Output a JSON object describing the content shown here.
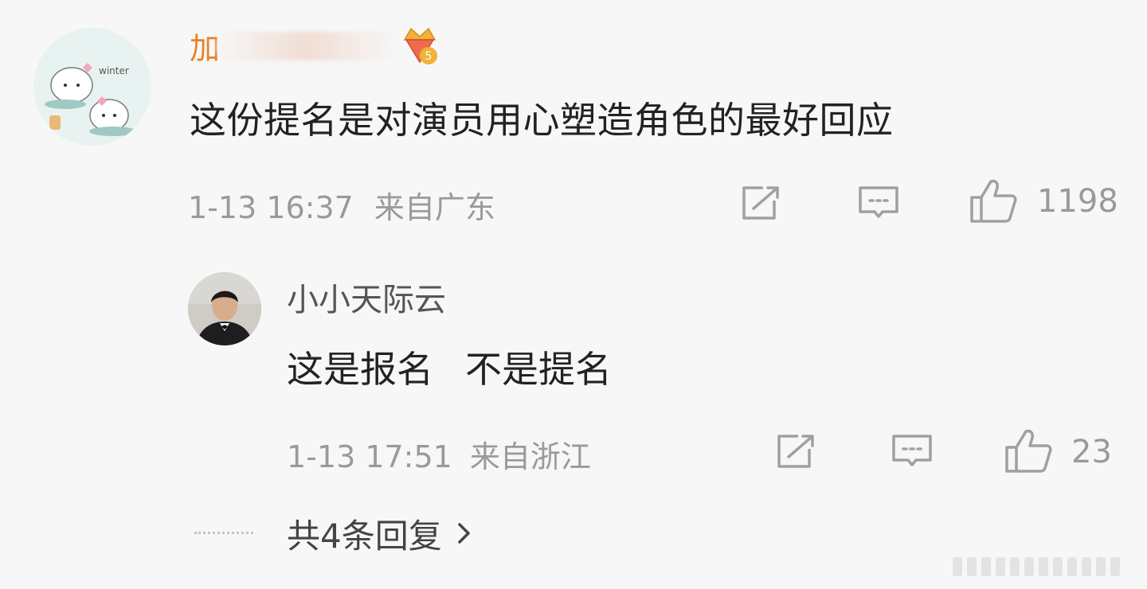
{
  "comment": {
    "username": "加",
    "content": "这份提名是对演员用心塑造角色的最好回应",
    "time": "1-13 16:37",
    "location": "来自广东",
    "likes": "1198",
    "badge": {
      "icon": "crown-badge-icon",
      "level": "5"
    },
    "avatar_text": "winter",
    "colors": {
      "username": "#e7832a",
      "text": "#222222",
      "meta": "#9a9a9a"
    }
  },
  "reply": {
    "username": "小小天际云",
    "content_parts": [
      "这是报名",
      "不是提名"
    ],
    "time": "1-13 17:51",
    "location": "来自浙江",
    "likes": "23"
  },
  "replies_link": {
    "label": "共4条回复",
    "icon": "chevron-right-icon"
  },
  "icons": [
    "share-icon",
    "comment-icon",
    "like-icon"
  ]
}
